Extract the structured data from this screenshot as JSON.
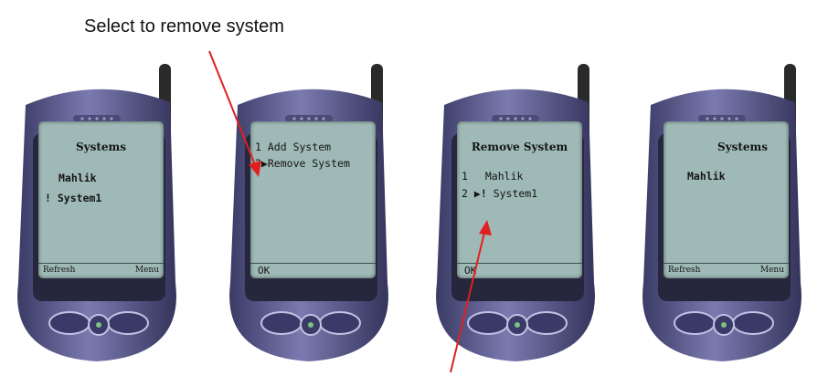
{
  "caption": "Select to remove system",
  "phones": [
    {
      "screen_title": "Systems",
      "items": [
        {
          "marker": "",
          "label": "Mahlik",
          "bold": true
        },
        {
          "marker": "!",
          "label": "System1",
          "bold": true
        }
      ],
      "softkeys": {
        "left": "Refresh",
        "right": "Menu"
      }
    },
    {
      "screen_title": "",
      "items": [
        {
          "number": "1",
          "label": "Add System"
        },
        {
          "number": "2",
          "cursor": "▶",
          "label": "Remove System"
        }
      ],
      "softkeys": {
        "left": "OK"
      }
    },
    {
      "screen_title": "Remove System",
      "items": [
        {
          "number": "1",
          "label": "Mahlik"
        },
        {
          "number": "2",
          "cursor": "▶",
          "marker": "!",
          "label": "System1"
        }
      ],
      "softkeys": {
        "left": "OK"
      }
    },
    {
      "screen_title": "Systems",
      "items": [
        {
          "label": "Mahlik",
          "bold": true
        }
      ],
      "softkeys": {
        "left": "Refresh",
        "right": "Menu"
      }
    }
  ],
  "colors": {
    "screen": "#9fbab6",
    "phone_body": "#5f5f94",
    "arrow": "#e02020"
  }
}
